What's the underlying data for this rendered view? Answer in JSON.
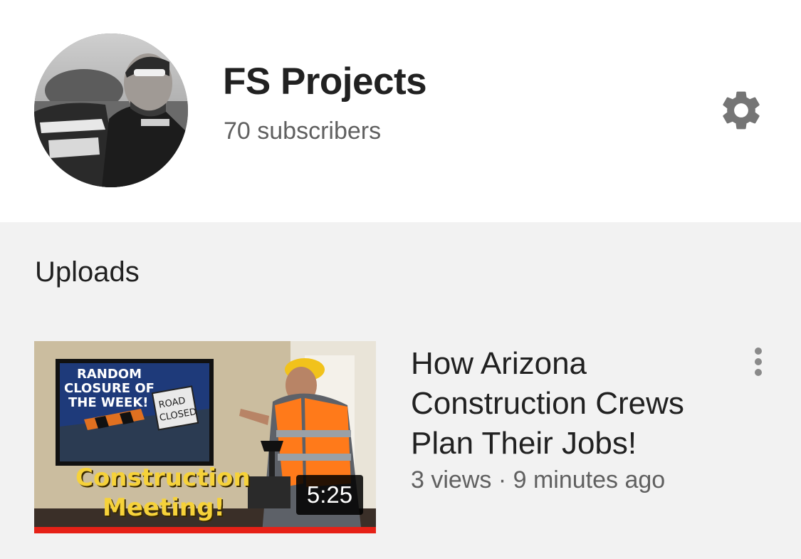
{
  "channel": {
    "name": "FS Projects",
    "subscribers": "70 subscribers",
    "avatar_icon": "channel-avatar",
    "settings_icon": "gear-icon"
  },
  "uploads": {
    "section_title": "Uploads",
    "videos": [
      {
        "title": "How Arizona Construction Crews Plan Their Jobs!",
        "views": "3 views",
        "separator": "·",
        "age": "9 minutes ago",
        "duration": "5:25",
        "watched_fraction": 1.0,
        "thumbnail_text": {
          "line1": "Construction",
          "line2": "Meeting!",
          "tv_line1": "RANDOM",
          "tv_line2": "CLOSURE OF",
          "tv_line3": "THE WEEK!",
          "sign_line1": "ROAD",
          "sign_line2": "CLOSED"
        },
        "more_icon": "more-vert-icon"
      }
    ]
  },
  "colors": {
    "header_bg": "#ffffff",
    "page_bg": "#f2f2f2",
    "progress": "#e62117",
    "title_text": "#212121",
    "secondary_text": "#606060"
  }
}
